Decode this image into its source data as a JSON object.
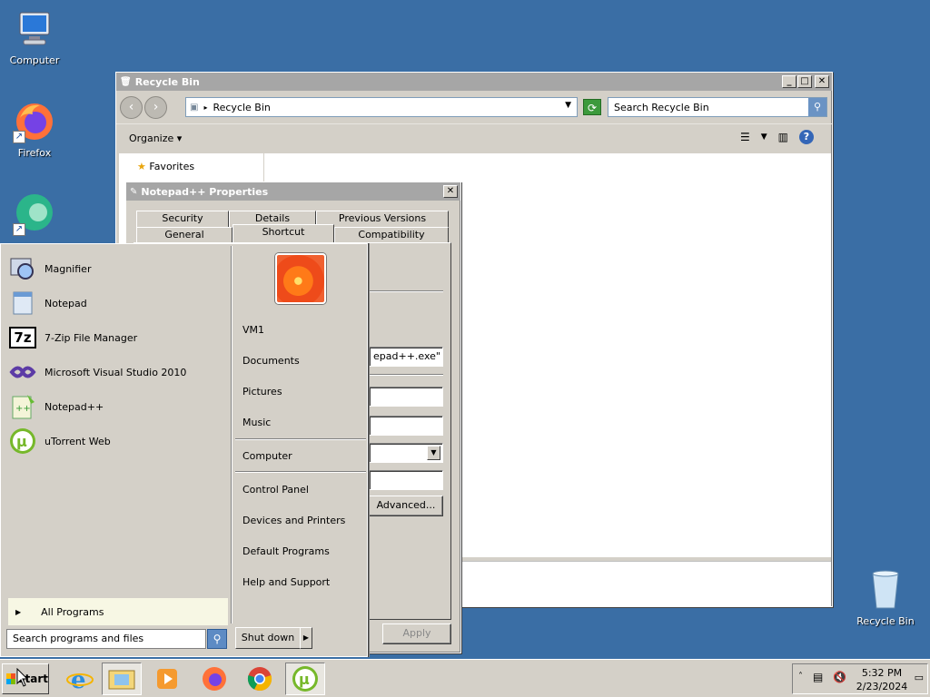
{
  "desktop": {
    "icons": [
      {
        "label": "Computer"
      },
      {
        "label": "Firefox"
      },
      {
        "label": "Recycle Bin"
      }
    ]
  },
  "explorer": {
    "title": "Recycle Bin",
    "address": "Recycle Bin",
    "search_placeholder": "Search Recycle Bin",
    "organize_label": "Organize",
    "nav": {
      "favorites": "Favorites"
    }
  },
  "properties": {
    "title": "Notepad++ Properties",
    "tabs_row1": [
      "Security",
      "Details",
      "Previous Versions"
    ],
    "tabs_row2": [
      "General",
      "Shortcut",
      "Compatibility"
    ],
    "active_tab": "Shortcut",
    "target_value": "epad++.exe\"",
    "advanced_label": "Advanced...",
    "apply_label": "Apply"
  },
  "start_menu": {
    "programs": [
      {
        "label": "Magnifier",
        "icon": "magnifier-icon"
      },
      {
        "label": "Notepad",
        "icon": "notepad-icon"
      },
      {
        "label": "7-Zip File Manager",
        "icon": "7zip-icon"
      },
      {
        "label": "Microsoft Visual Studio 2010",
        "icon": "visual-studio-icon"
      },
      {
        "label": "Notepad++",
        "icon": "notepadpp-icon"
      },
      {
        "label": "uTorrent Web",
        "icon": "utorrent-icon"
      }
    ],
    "all_programs": "All Programs",
    "search_placeholder": "Search programs and files",
    "right_items": {
      "user": "VM1",
      "documents": "Documents",
      "pictures": "Pictures",
      "music": "Music",
      "computer": "Computer",
      "control_panel": "Control Panel",
      "devices": "Devices and Printers",
      "default_programs": "Default Programs",
      "help": "Help and Support"
    },
    "shutdown_label": "Shut down"
  },
  "taskbar": {
    "start_label": "Start",
    "apps": [
      "internet-explorer-icon",
      "file-explorer-icon",
      "media-player-icon",
      "firefox-icon",
      "chrome-icon",
      "utorrent-icon"
    ],
    "clock_time": "5:32 PM",
    "clock_date": "2/23/2024"
  }
}
